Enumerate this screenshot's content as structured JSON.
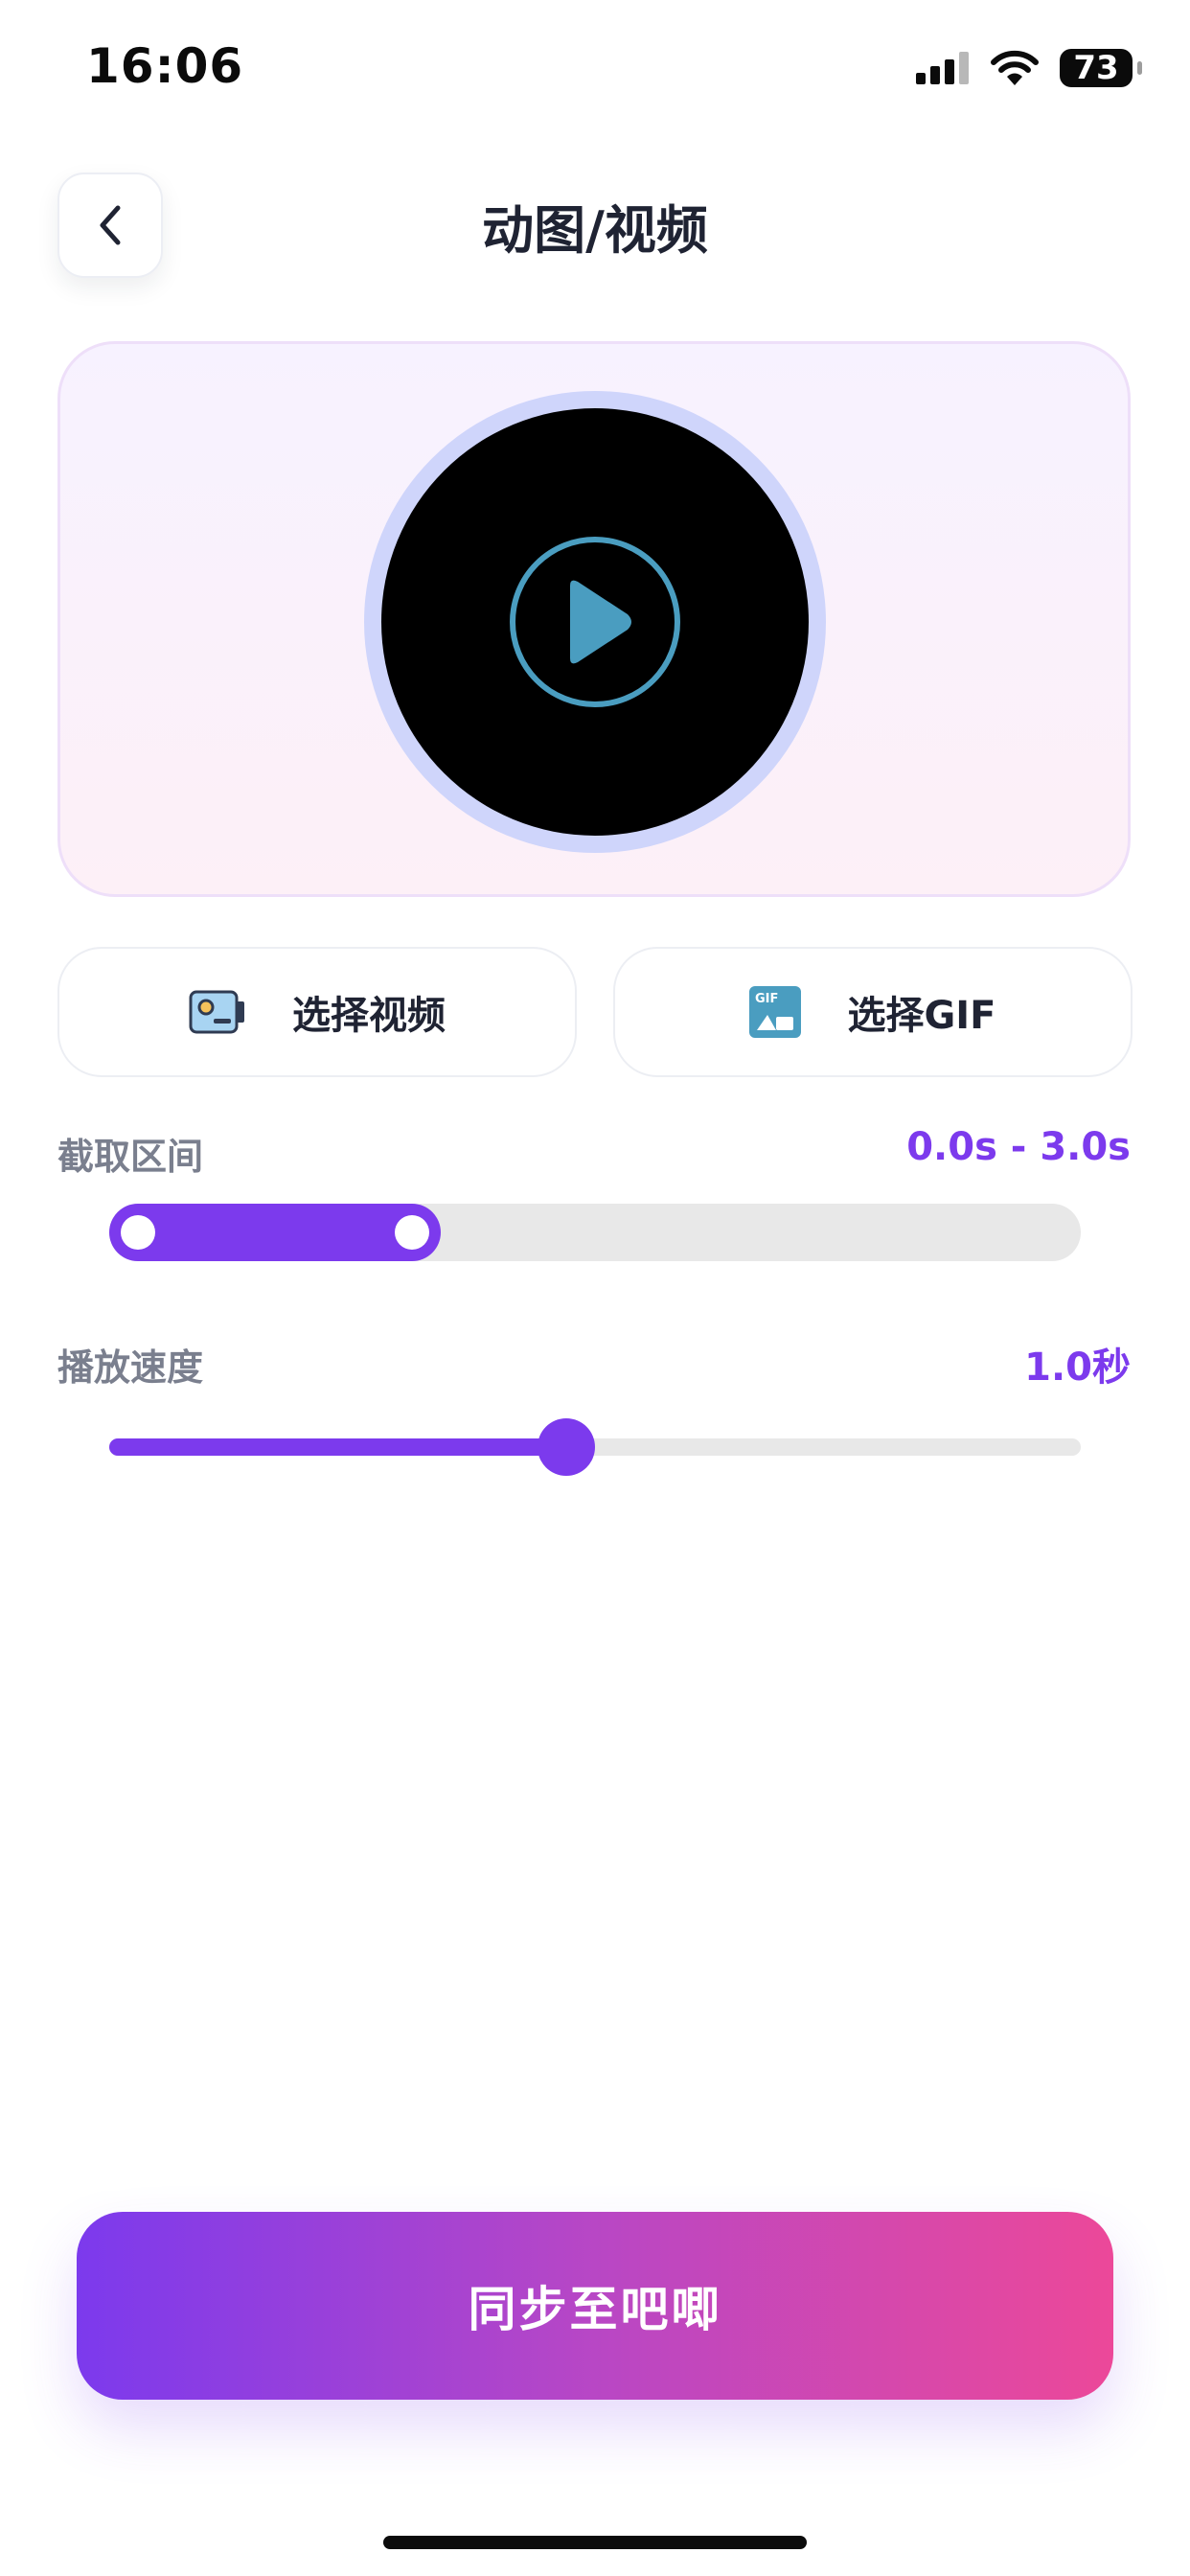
{
  "status_bar": {
    "time": "16:06",
    "battery": "73"
  },
  "header": {
    "title": "动图/视频"
  },
  "preview": {
    "play_icon": "play-icon"
  },
  "actions": {
    "select_video": "选择视频",
    "select_gif": "选择GIF",
    "gif_icon_text": "GIF"
  },
  "clip_range": {
    "label": "截取区间",
    "value": "0.0s - 3.0s",
    "start_fraction": 0.0,
    "end_fraction": 0.3
  },
  "playback_speed": {
    "label": "播放速度",
    "value": "1.0秒",
    "fraction": 0.47
  },
  "sync": {
    "label": "同步至吧唧"
  },
  "colors": {
    "accent": "#7c3aed",
    "accent_end": "#ec4899",
    "ring": "#cfd5fb",
    "play": "#4a9dc0"
  }
}
